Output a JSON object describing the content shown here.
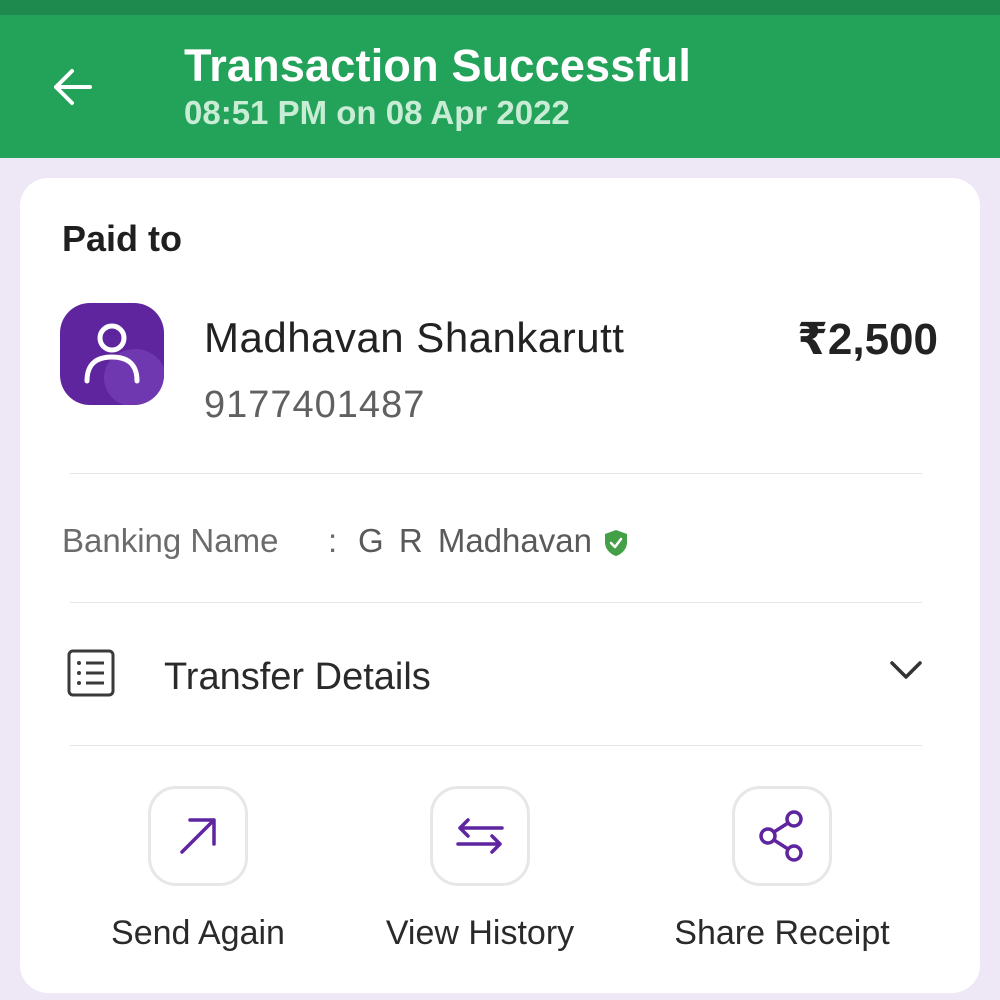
{
  "header": {
    "title": "Transaction Successful",
    "subtitle": "08:51 PM on 08 Apr 2022",
    "back_icon": "arrow-left-icon",
    "color": "#23a25a"
  },
  "card": {
    "paid_to_label": "Paid to",
    "payee": {
      "name": "Madhavan Shankarutt",
      "phone": "9177401487",
      "amount": "₹2,500",
      "avatar_icon": "person-icon",
      "avatar_color": "#5f259f"
    },
    "banking": {
      "label": "Banking Name",
      "separator": ":",
      "value": "G R  Madhavan",
      "verified_icon": "verified-shield-icon",
      "verified_color": "#43a047"
    },
    "transfer_details": {
      "label": "Transfer Details",
      "icon": "receipt-list-icon",
      "expand_icon": "chevron-down-icon"
    },
    "actions": [
      {
        "label": "Send Again",
        "icon": "arrow-up-right-icon"
      },
      {
        "label": "View History",
        "icon": "swap-arrows-icon"
      },
      {
        "label": "Share Receipt",
        "icon": "share-icon"
      }
    ],
    "accent_color": "#5f259f"
  }
}
